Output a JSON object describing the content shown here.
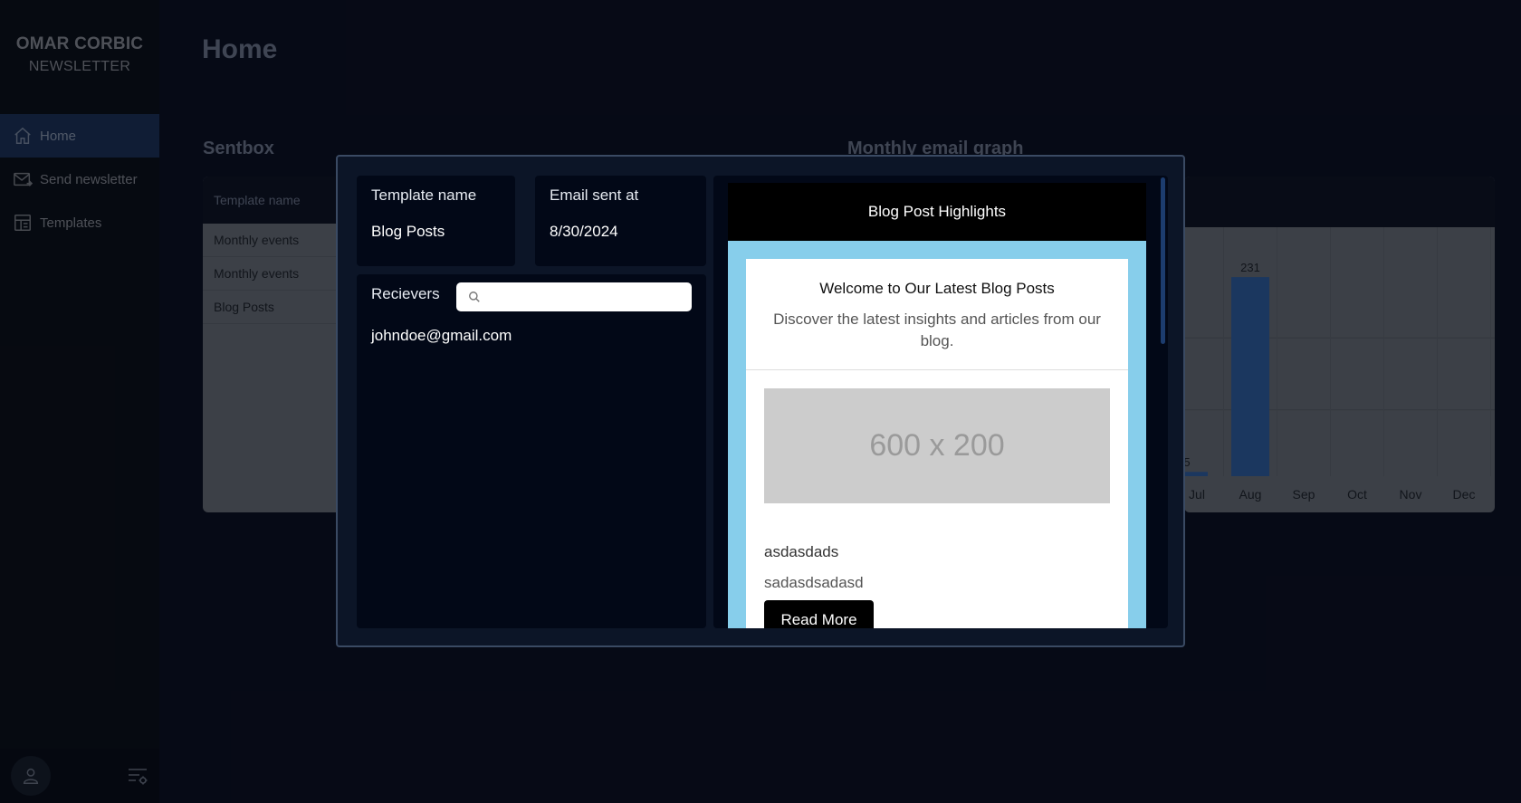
{
  "brand": {
    "title": "OMAR CORBIC",
    "subtitle": "NEWSLETTER"
  },
  "sidebar": {
    "items": [
      {
        "label": "Home",
        "icon": "home-icon",
        "active": true
      },
      {
        "label": "Send newsletter",
        "icon": "mail-send-icon",
        "active": false
      },
      {
        "label": "Templates",
        "icon": "template-icon",
        "active": false
      }
    ]
  },
  "page": {
    "title": "Home"
  },
  "sentbox": {
    "title": "Sentbox",
    "column_header": "Template name",
    "rows": [
      "Monthly events",
      "Monthly events",
      "Blog Posts"
    ]
  },
  "graph": {
    "title": "Monthly email graph"
  },
  "chart_data": {
    "type": "bar",
    "categories": [
      "Jul",
      "Aug",
      "Sep",
      "Oct",
      "Nov",
      "Dec"
    ],
    "values": [
      5,
      231,
      0,
      0,
      0,
      0
    ],
    "data_labels": [
      "5",
      "231"
    ],
    "color": "#2f5d9e",
    "grid": true
  },
  "modal": {
    "template_name_label": "Template name",
    "template_name_value": "Blog Posts",
    "email_sent_label": "Email sent at",
    "email_sent_value": "8/30/2024",
    "receivers_label": "Recievers",
    "search_value": "",
    "receivers": [
      "johndoe@gmail.com"
    ]
  },
  "email_preview": {
    "header": "Blog Post Highlights",
    "title": "Welcome to Our Latest Blog Posts",
    "description": "Discover the latest insights and articles from our blog.",
    "image_placeholder": "600 x 200",
    "post_title": "asdasdads",
    "post_text": "sadasdsadasd",
    "button_label": "Read More"
  },
  "colors": {
    "background": "#080c1a",
    "sidebar": "#090b11",
    "active_nav": "#1a2f52",
    "modal": "#0c1527",
    "card": "#020817",
    "email_bg": "#87ceeb",
    "bar": "#2f5d9e"
  }
}
